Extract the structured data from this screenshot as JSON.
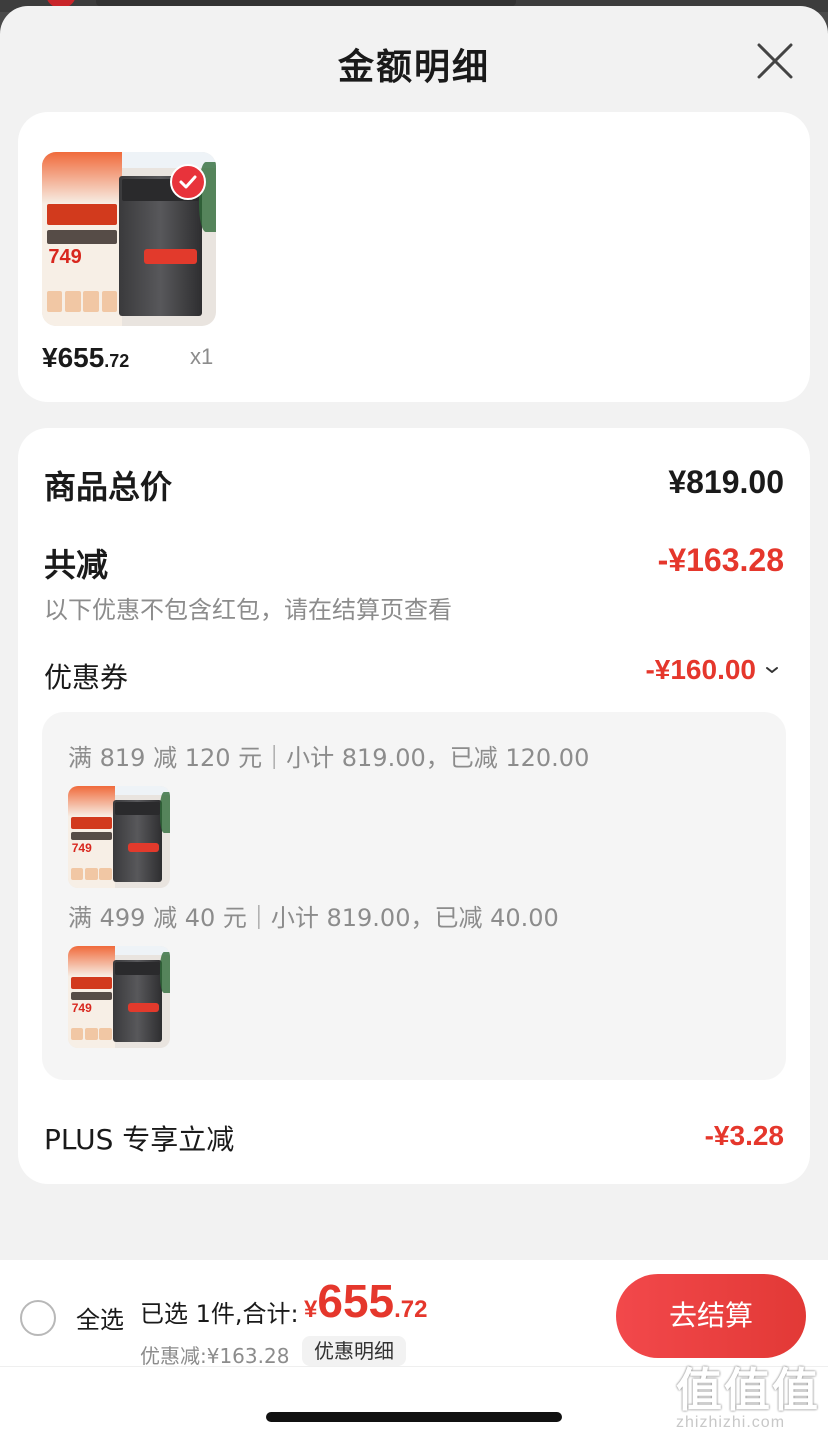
{
  "sheet": {
    "title": "金额明细"
  },
  "product": {
    "thumb_promo_price": "749",
    "price_int": "¥655",
    "price_dec": ".72",
    "quantity": "x1",
    "selected": true
  },
  "summary": {
    "total_label": "商品总价",
    "total_value": "¥819.00",
    "reduce_label": "共减",
    "reduce_value": "-¥163.28",
    "note": "以下优惠不包含红包，请在结算页查看",
    "coupon_label": "优惠券",
    "coupon_value": "-¥160.00",
    "coupons": [
      {
        "text": "满 819 减 120 元｜小计 819.00，已减 120.00",
        "thumb_price": "749"
      },
      {
        "text": "满 499 减 40 元｜小计 819.00，已减 40.00",
        "thumb_price": "749"
      }
    ],
    "plus_label": "PLUS 专享立减",
    "plus_value": "-¥3.28"
  },
  "bottom_bar": {
    "select_all_label": "全选",
    "selected_text": "已选 1件,合计:",
    "total_symbol": "¥",
    "total_int": "655",
    "total_dec": ".72",
    "discount_text": "优惠减:¥163.28",
    "detail_link": "优惠明细",
    "checkout_label": "去结算"
  },
  "watermark": {
    "glyphs": "值值值",
    "url": "zhizhizhi.com"
  },
  "colors": {
    "accent_red": "#e5372c",
    "button_red": "#f2484b",
    "gray_text": "#8c8c8c"
  }
}
